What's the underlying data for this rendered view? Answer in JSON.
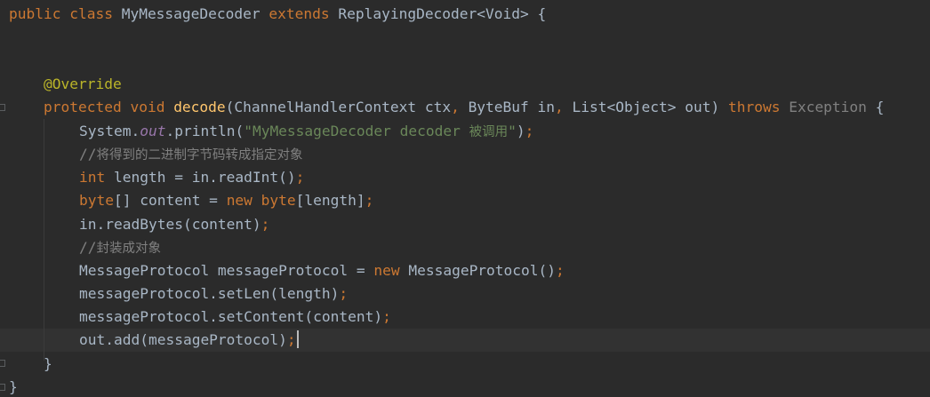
{
  "editor": {
    "background": "#2b2b2b",
    "current_line_background": "#323232",
    "colors": {
      "keyword": "#cc7832",
      "plain": "#a9b7c6",
      "method": "#ffc66d",
      "annotation": "#bbb529",
      "string": "#6a8759",
      "static_field": "#9876aa",
      "comment": "#808080"
    },
    "lines": {
      "l1": {
        "t1": "public class ",
        "t2": "MyMessageDecoder ",
        "t3": "extends ",
        "t4": "ReplayingDecoder<Void> {"
      },
      "l4": {
        "t1": "@Override"
      },
      "l5": {
        "t1": "protected void ",
        "t2": "decode",
        "t3": "(ChannelHandlerContext ctx",
        "t4": ", ",
        "t5": "ByteBuf in",
        "t6": ", ",
        "t7": "List<Object> out) ",
        "t8": "throws ",
        "t9": "Exception ",
        "t10": "{"
      },
      "l6": {
        "t1": "System.",
        "t2": "out",
        "t3": ".println(",
        "t4": "\"MyMessageDecoder decoder ",
        "t5": "被调用",
        "t6": "\"",
        "t7": ")",
        "t8": ";"
      },
      "l7": {
        "t1": "//",
        "t2": "将得到的二进制字节码转成指定对象"
      },
      "l8": {
        "t1": "int ",
        "t2": "length = in.readInt()",
        "t3": ";"
      },
      "l9": {
        "t1": "byte",
        "t2": "[] content = ",
        "t3": "new ",
        "t4": "byte",
        "t5": "[length]",
        "t6": ";"
      },
      "l10": {
        "t1": "in.readBytes(content)",
        "t2": ";"
      },
      "l11": {
        "t1": "//",
        "t2": "封装成对象"
      },
      "l12": {
        "t1": "MessageProtocol messageProtocol = ",
        "t2": "new ",
        "t3": "MessageProtocol()",
        "t4": ";"
      },
      "l13": {
        "t1": "messageProtocol.setLen(length)",
        "t2": ";"
      },
      "l14": {
        "t1": "messageProtocol.setContent(content)",
        "t2": ";"
      },
      "l15": {
        "t1": "out.add(messageProtocol)",
        "t2": ";"
      },
      "l16": {
        "t1": "}"
      },
      "l17": {
        "t1": "}"
      }
    }
  }
}
